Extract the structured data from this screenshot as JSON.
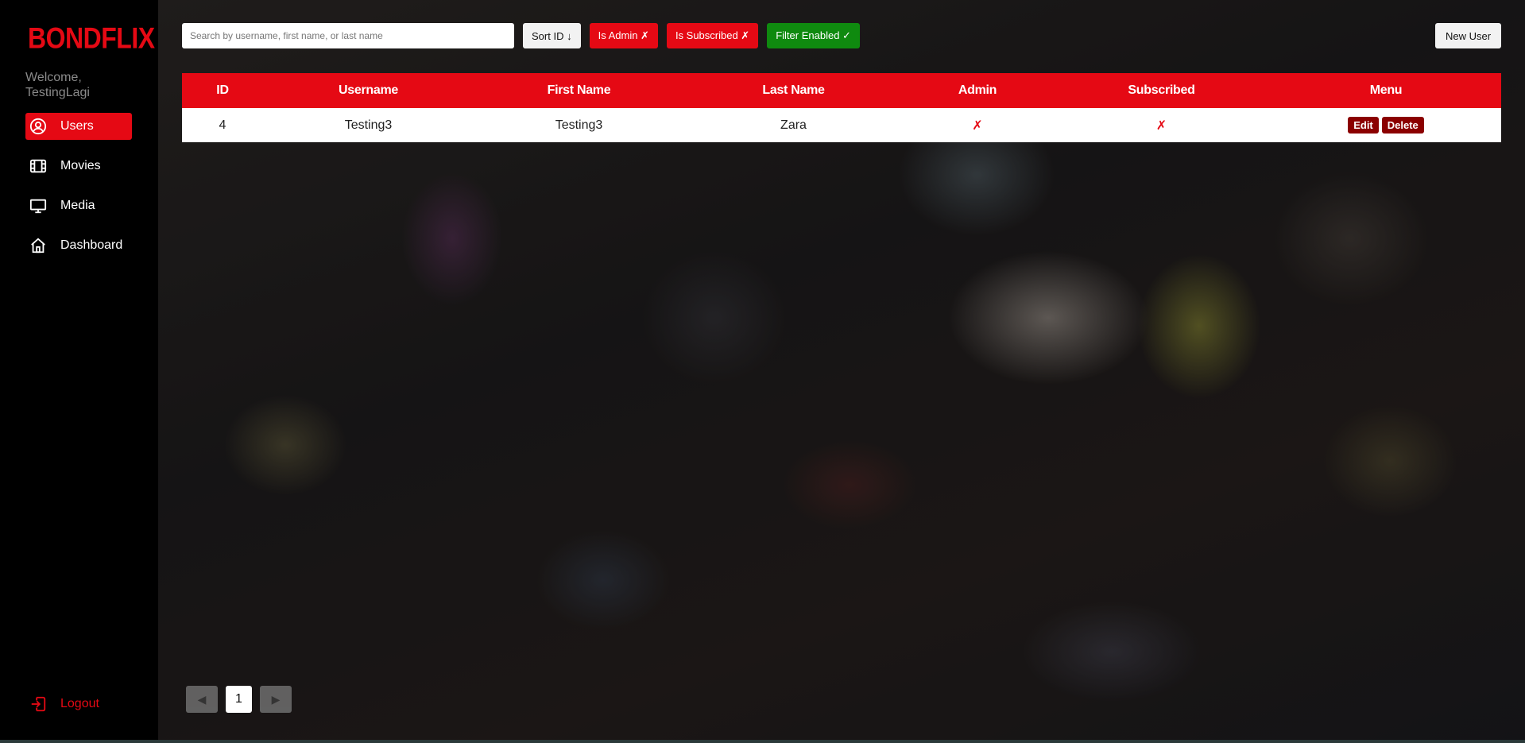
{
  "brand": {
    "logo": "BONDFLIX",
    "accent": "#e50914"
  },
  "sidebar": {
    "welcome_prefix": "Welcome,",
    "username": "TestingLagi",
    "items": [
      {
        "label": "Users",
        "icon": "user-circle-icon",
        "active": true
      },
      {
        "label": "Movies",
        "icon": "film-icon",
        "active": false
      },
      {
        "label": "Media",
        "icon": "monitor-icon",
        "active": false
      },
      {
        "label": "Dashboard",
        "icon": "home-icon",
        "active": false
      }
    ],
    "logout_label": "Logout"
  },
  "toolbar": {
    "search_placeholder": "Search by username, first name, or last name",
    "search_value": "",
    "sort_label": "Sort ID ↓",
    "is_admin_label": "Is Admin ✗",
    "is_subscribed_label": "Is Subscribed ✗",
    "filter_label": "Filter Enabled ✓",
    "new_user_label": "New User"
  },
  "table": {
    "headers": [
      "ID",
      "Username",
      "First Name",
      "Last Name",
      "Admin",
      "Subscribed",
      "Menu"
    ],
    "rows": [
      {
        "id": "4",
        "username": "Testing3",
        "first_name": "Testing3",
        "last_name": "Zara",
        "admin": "✗",
        "subscribed": "✗",
        "edit_label": "Edit",
        "delete_label": "Delete"
      }
    ]
  },
  "pagination": {
    "prev_label": "◀",
    "current_page": "1",
    "next_label": "▶"
  }
}
